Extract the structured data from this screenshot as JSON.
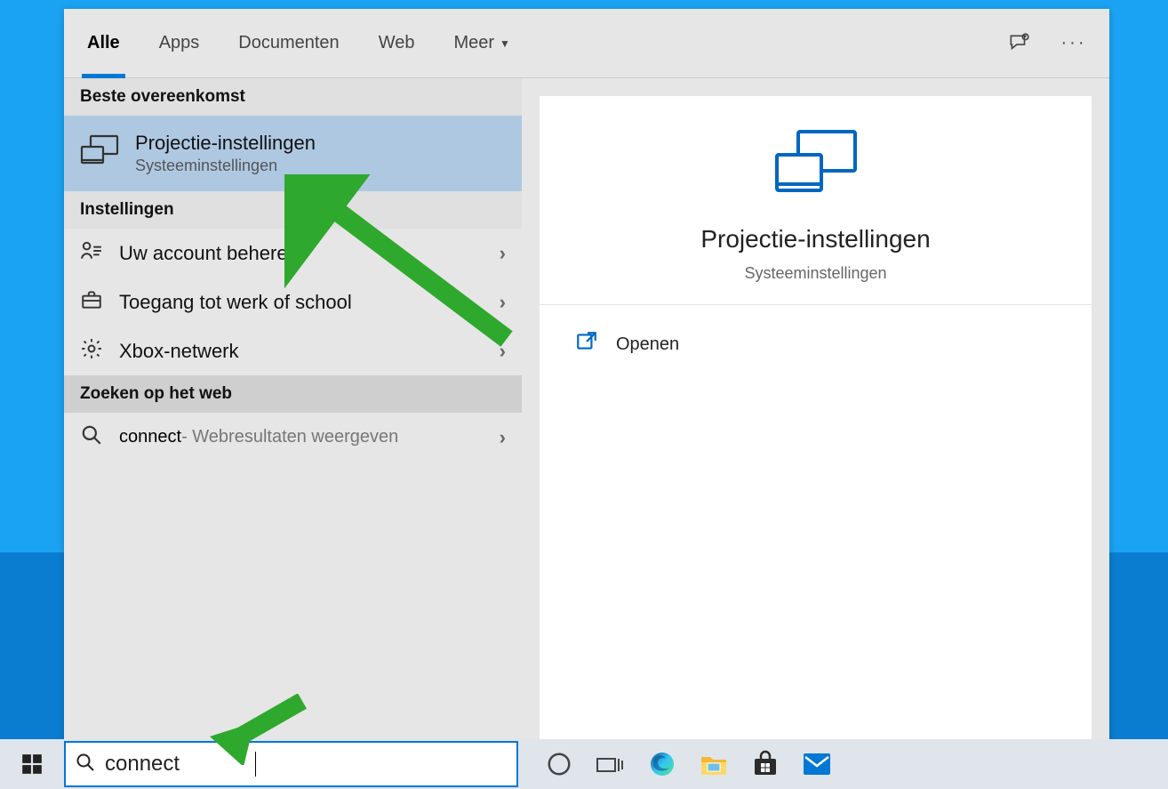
{
  "tabs": {
    "all": "Alle",
    "apps": "Apps",
    "documents": "Documenten",
    "web": "Web",
    "more": "Meer"
  },
  "sections": {
    "best_match": "Beste overeenkomst",
    "settings": "Instellingen",
    "web_search": "Zoeken op het web"
  },
  "results": {
    "best": {
      "title": "Projectie-instellingen",
      "subtitle": "Systeeminstellingen"
    },
    "settings_items": [
      {
        "label": "Uw account beheren"
      },
      {
        "label": "Toegang tot werk of school"
      },
      {
        "label": "Xbox-netwerk"
      }
    ],
    "web": {
      "term": "connect",
      "suffix": " - Webresultaten weergeven"
    }
  },
  "preview": {
    "title": "Projectie-instellingen",
    "subtitle": "Systeeminstellingen",
    "open_label": "Openen"
  },
  "search": {
    "value": "connect"
  }
}
